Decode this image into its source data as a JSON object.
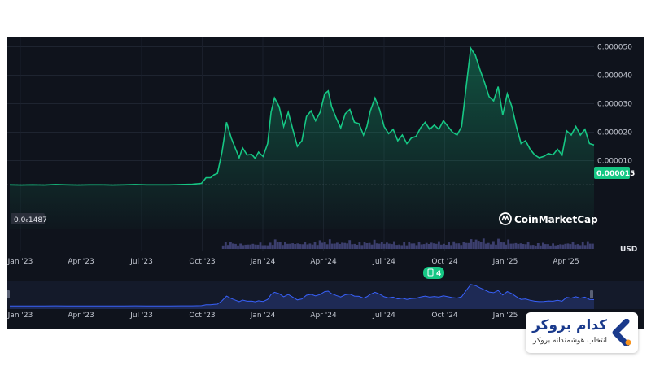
{
  "colors": {
    "background": "#0f131c",
    "line": "#16c784",
    "volume": "#3c3f6e",
    "navigator_line": "#3861fb",
    "badge": "#16c784",
    "brand_blue": "#1a3a8c",
    "brand_orange": "#f7931e"
  },
  "chart_data": {
    "type": "line",
    "y_axis": {
      "ticks": [
        {
          "value": 1e-05,
          "label": "0.000010"
        },
        {
          "value": 2e-05,
          "label": "0.000020"
        },
        {
          "value": 3e-05,
          "label": "0.000030"
        },
        {
          "value": 4e-05,
          "label": "0.000040"
        },
        {
          "value": 5e-05,
          "label": "0.000050"
        }
      ],
      "unit_label": "USD",
      "position": "right"
    },
    "x_axis": {
      "ticks": [
        "Jan '23",
        "Apr '23",
        "Jul '23",
        "Oct '23",
        "Jan '24",
        "Apr '24",
        "Jul '24",
        "Oct '24",
        "Jan '25",
        "Apr '25"
      ]
    },
    "baseline": {
      "value": 1.487e-06,
      "label": "0.0₆1487"
    },
    "current": {
      "value": 1.5e-05,
      "label": "0.000015"
    },
    "watermark": "CoinMarketCap",
    "events_badge": "4",
    "series": [
      {
        "values": [
          [
            0,
            1.5e-06
          ],
          [
            5,
            1.4e-06
          ],
          [
            10,
            1.5e-06
          ],
          [
            15,
            1.4e-06
          ],
          [
            20,
            1.6e-06
          ],
          [
            25,
            1.5e-06
          ],
          [
            30,
            1.4e-06
          ],
          [
            35,
            1.5e-06
          ],
          [
            40,
            1.5e-06
          ],
          [
            45,
            1.4e-06
          ],
          [
            50,
            1.5e-06
          ],
          [
            55,
            1.6e-06
          ],
          [
            60,
            1.5e-06
          ],
          [
            65,
            1.5e-06
          ],
          [
            70,
            1.5e-06
          ],
          [
            75,
            1.6e-06
          ],
          [
            80,
            1.7e-06
          ],
          [
            84,
            2e-06
          ],
          [
            86,
            4e-06
          ],
          [
            88,
            4e-06
          ],
          [
            89.5,
            5e-06
          ],
          [
            91,
            5.5e-06
          ],
          [
            93,
            1.3e-05
          ],
          [
            95,
            2.35e-05
          ],
          [
            97,
            1.8e-05
          ],
          [
            99,
            1.4e-05
          ],
          [
            100.5,
            1.1e-05
          ],
          [
            102,
            1.45e-05
          ],
          [
            104,
            1.2e-05
          ],
          [
            106,
            1.22e-05
          ],
          [
            107.5,
            1.08e-05
          ],
          [
            109,
            1.3e-05
          ],
          [
            111,
            1.15e-05
          ],
          [
            113,
            1.6e-05
          ],
          [
            114.5,
            2.7e-05
          ],
          [
            116,
            3.2e-05
          ],
          [
            118,
            2.9e-05
          ],
          [
            120,
            2.2e-05
          ],
          [
            122,
            2.7e-05
          ],
          [
            124,
            2.1e-05
          ],
          [
            126,
            1.5e-05
          ],
          [
            128,
            1.7e-05
          ],
          [
            130,
            2.55e-05
          ],
          [
            132,
            2.75e-05
          ],
          [
            134,
            2.4e-05
          ],
          [
            136,
            2.7e-05
          ],
          [
            138,
            3.35e-05
          ],
          [
            139.5,
            3.45e-05
          ],
          [
            141,
            2.9e-05
          ],
          [
            143,
            2.5e-05
          ],
          [
            145,
            2.15e-05
          ],
          [
            147,
            2.65e-05
          ],
          [
            149,
            2.8e-05
          ],
          [
            151,
            2.35e-05
          ],
          [
            153,
            2.3e-05
          ],
          [
            155,
            1.9e-05
          ],
          [
            156.5,
            2.2e-05
          ],
          [
            158,
            2.75e-05
          ],
          [
            160,
            3.2e-05
          ],
          [
            162,
            2.8e-05
          ],
          [
            164,
            2.2e-05
          ],
          [
            166,
            1.95e-05
          ],
          [
            168,
            2.1e-05
          ],
          [
            170,
            1.7e-05
          ],
          [
            172,
            1.9e-05
          ],
          [
            174,
            1.6e-05
          ],
          [
            176,
            1.8e-05
          ],
          [
            178,
            1.85e-05
          ],
          [
            180,
            2.15e-05
          ],
          [
            182,
            2.35e-05
          ],
          [
            184,
            2.1e-05
          ],
          [
            186,
            2.25e-05
          ],
          [
            188,
            2.1e-05
          ],
          [
            190,
            2.4e-05
          ],
          [
            192,
            2.2e-05
          ],
          [
            194,
            2e-05
          ],
          [
            196,
            1.9e-05
          ],
          [
            198,
            2.2e-05
          ],
          [
            200,
            3.6e-05
          ],
          [
            202,
            4.95e-05
          ],
          [
            204,
            4.7e-05
          ],
          [
            206,
            4.2e-05
          ],
          [
            208,
            3.75e-05
          ],
          [
            210,
            3.25e-05
          ],
          [
            212,
            3.1e-05
          ],
          [
            214,
            3.6e-05
          ],
          [
            216,
            2.6e-05
          ],
          [
            218,
            3.35e-05
          ],
          [
            220,
            2.9e-05
          ],
          [
            222,
            2.2e-05
          ],
          [
            224,
            1.6e-05
          ],
          [
            226,
            1.7e-05
          ],
          [
            228,
            1.4e-05
          ],
          [
            230,
            1.2e-05
          ],
          [
            232,
            1.1e-05
          ],
          [
            234,
            1.15e-05
          ],
          [
            236,
            1.25e-05
          ],
          [
            238,
            1.2e-05
          ],
          [
            240,
            1.4e-05
          ],
          [
            242,
            1.2e-05
          ],
          [
            244,
            2.05e-05
          ],
          [
            246,
            1.9e-05
          ],
          [
            248,
            2.2e-05
          ],
          [
            250,
            1.9e-05
          ],
          [
            252,
            2.1e-05
          ],
          [
            254,
            1.6e-05
          ],
          [
            256,
            1.55e-05
          ]
        ]
      }
    ]
  }
}
